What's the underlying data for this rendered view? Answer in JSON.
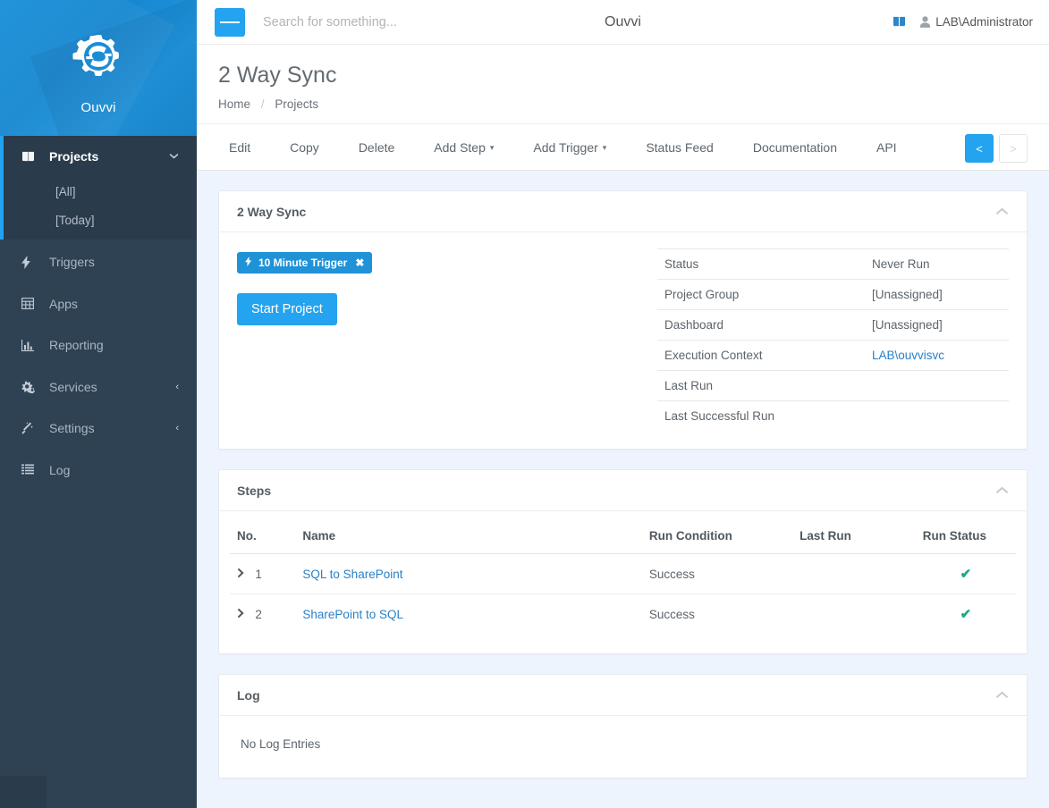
{
  "brand": {
    "name": "Ouvvi",
    "logo_icon": "gear-s-logo"
  },
  "sidebar": {
    "active_group": {
      "label": "Projects",
      "icon": "book-icon",
      "caret_icon": "chevron-down-icon",
      "children": [
        {
          "label": "[All]"
        },
        {
          "label": "[Today]"
        }
      ]
    },
    "items": [
      {
        "label": "Triggers",
        "icon": "bolt-icon",
        "caret": ""
      },
      {
        "label": "Apps",
        "icon": "grid-icon",
        "caret": ""
      },
      {
        "label": "Reporting",
        "icon": "bar-chart-icon",
        "caret": ""
      },
      {
        "label": "Services",
        "icon": "gears-icon",
        "caret": "‹"
      },
      {
        "label": "Settings",
        "icon": "wand-icon",
        "caret": "‹"
      },
      {
        "label": "Log",
        "icon": "list-icon",
        "caret": ""
      }
    ]
  },
  "topbar": {
    "menu_icon": "hamburger-icon",
    "search_placeholder": "Search for something...",
    "search_value": "",
    "title": "Ouvvi",
    "doc_icon": "book-icon",
    "user_icon": "user-icon",
    "user_name": "LAB\\Administrator"
  },
  "pagehead": {
    "title": "2 Way Sync",
    "breadcrumb": [
      "Home",
      "Projects"
    ],
    "breadcrumb_separator": "/",
    "pager": {
      "prev": "<",
      "next": ">"
    }
  },
  "toolbar": {
    "items": [
      {
        "label": "Edit",
        "dropdown": false
      },
      {
        "label": "Copy",
        "dropdown": false
      },
      {
        "label": "Delete",
        "dropdown": false
      },
      {
        "label": "Add Step",
        "dropdown": true
      },
      {
        "label": "Add Trigger",
        "dropdown": true
      },
      {
        "label": "Status Feed",
        "dropdown": false
      },
      {
        "label": "Documentation",
        "dropdown": false
      },
      {
        "label": "API",
        "dropdown": false
      }
    ],
    "caret_glyph": "▾"
  },
  "overview_panel": {
    "title": "2 Way Sync",
    "collapse_icon": "chevron-up-icon",
    "trigger_badge": {
      "icon": "bolt-icon",
      "label": "10 Minute Trigger",
      "remove": "✖"
    },
    "start_button": "Start Project",
    "details": [
      {
        "key": "Status",
        "value": "Never Run",
        "link": false
      },
      {
        "key": "Project Group",
        "value": "[Unassigned]",
        "link": false
      },
      {
        "key": "Dashboard",
        "value": "[Unassigned]",
        "link": false
      },
      {
        "key": "Execution Context",
        "value": "LAB\\ouvvisvc",
        "link": true
      },
      {
        "key": "Last Run",
        "value": "",
        "link": false
      },
      {
        "key": "Last Successful Run",
        "value": "",
        "link": false
      }
    ]
  },
  "steps_panel": {
    "title": "Steps",
    "collapse_icon": "chevron-up-icon",
    "columns": [
      "No.",
      "Name",
      "Run Condition",
      "Last Run",
      "Run Status"
    ],
    "rows": [
      {
        "no": "1",
        "name": "SQL to SharePoint",
        "condition": "Success",
        "last_run": "",
        "status": "✔"
      },
      {
        "no": "2",
        "name": "SharePoint to SQL",
        "condition": "Success",
        "last_run": "",
        "status": "✔"
      }
    ]
  },
  "log_panel": {
    "title": "Log",
    "collapse_icon": "chevron-up-icon",
    "empty_text": "No Log Entries"
  },
  "colors": {
    "accent_blue": "#23a3f0",
    "sidebar": "#2f4254",
    "sidebar_active": "#2a3b4c",
    "link_blue": "#2980c8",
    "success_green": "#18a887",
    "content_bg": "#eef4fd"
  }
}
